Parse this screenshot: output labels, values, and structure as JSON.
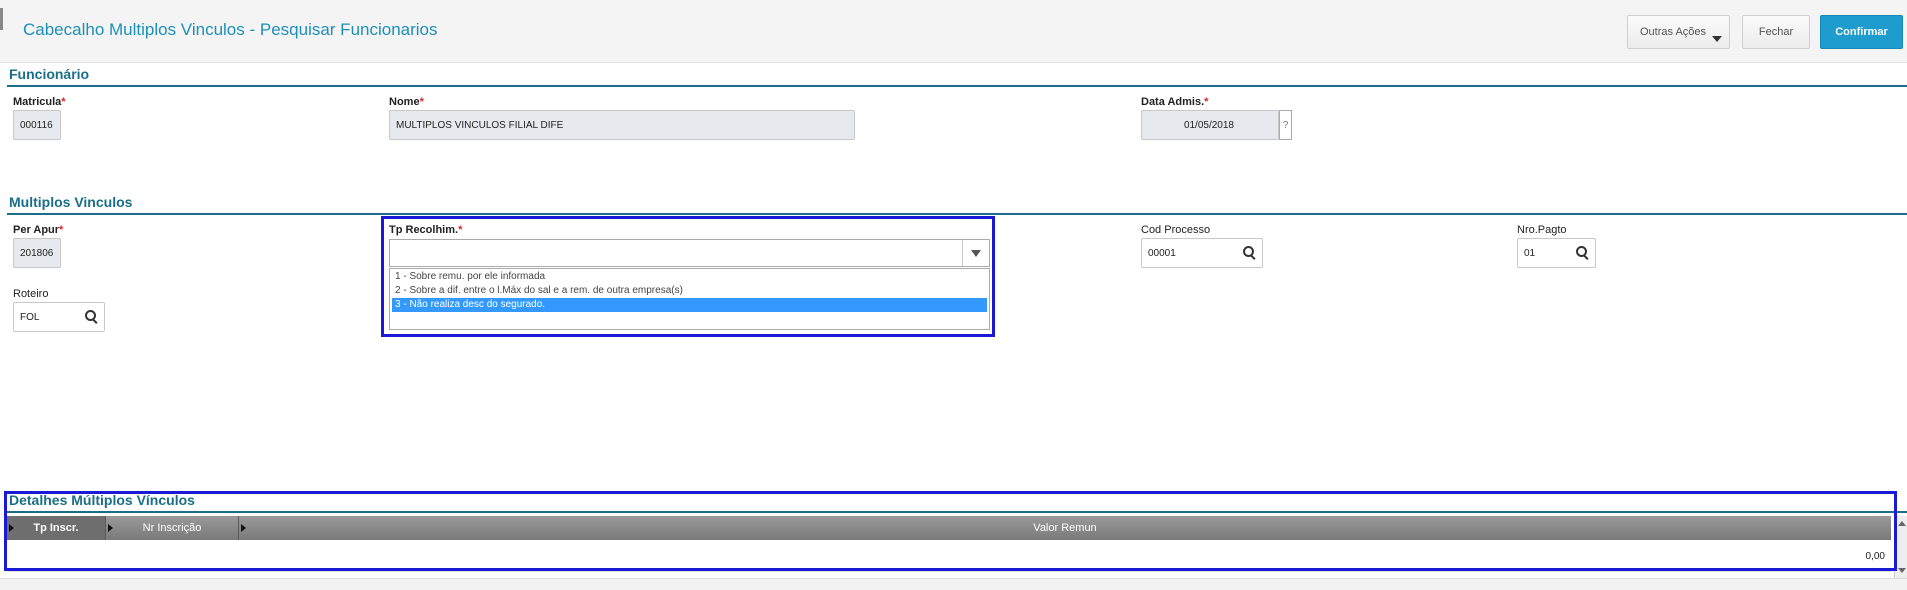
{
  "header": {
    "title": "Cabecalho Multiplos Vinculos - Pesquisar Funcionarios",
    "buttons": {
      "outras": "Outras Ações",
      "fechar": "Fechar",
      "confirmar": "Confirmar"
    }
  },
  "funcionario": {
    "title": "Funcionário",
    "matricula": {
      "label": "Matricula",
      "value": "000116"
    },
    "nome": {
      "label": "Nome",
      "value": "MULTIPLOS VINCULOS FILIAL DIFE"
    },
    "data_admis": {
      "label": "Data Admis.",
      "value": "01/05/2018",
      "help": "?"
    }
  },
  "multiplos": {
    "title": "Multiplos Vinculos",
    "per_apur": {
      "label": "Per Apur",
      "value": "201806"
    },
    "tp_recolhim": {
      "label": "Tp Recolhim.",
      "value": "",
      "options": [
        "1 - Sobre remu. por ele informada",
        "2 - Sobre a dif. entre o l.Máx do sal e a rem. de outra empresa(s)",
        "3 - Não realiza desc do segurado."
      ],
      "selected_index": 2
    },
    "cod_processo": {
      "label": "Cod Processo",
      "value": "00001"
    },
    "nro_pagto": {
      "label": "Nro.Pagto",
      "value": "01"
    },
    "roteiro": {
      "label": "Roteiro",
      "value": "FOL"
    }
  },
  "detalhes": {
    "title": "Detalhes Múltiplos Vínculos",
    "columns": [
      "Tp Inscr.",
      "Nr Inscrição",
      "Valor Remun"
    ],
    "rows": [
      {
        "tp_inscr": "",
        "nr_inscricao": "",
        "valor_remun": "0,00"
      }
    ]
  },
  "colors": {
    "accent": "#1d9ccd",
    "section": "#1a6e87",
    "highlight": "#1a1ad6",
    "selected": "#3399ff"
  }
}
